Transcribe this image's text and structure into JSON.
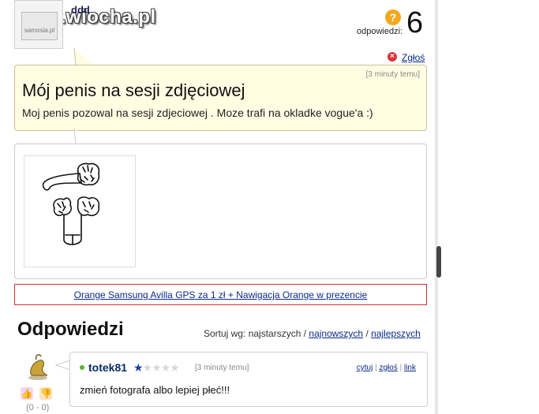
{
  "watermark": "www.wiocha.pl",
  "top": {
    "username": "ddd",
    "avatar_text": "samosia.pl",
    "answers_label": "odpowiedzi:",
    "answers_count": "6",
    "answers_icon": "question-mark-icon",
    "report_label": "Zgłoś"
  },
  "question": {
    "time": "[3 minuty temu]",
    "title": "Mój penis na sesji zdjęciowej",
    "body": "Moj penis pozowal na sesji zdjeciowej . Moze trafi na okladke vogue'a :)"
  },
  "ad": {
    "link_text": "Orange Samsung Avilla GPS za 1 zł + Nawigacja Orange w prezencie"
  },
  "answers": {
    "heading": "Odpowiedzi",
    "sort_label": "Sortuj wg: najstarszych /",
    "sort_newest": "najnowszych",
    "sort_sep": "/",
    "sort_best": "najlepszych"
  },
  "reply": {
    "username": "totek81",
    "rating": 1,
    "rating_max": 5,
    "time": "[3 minuty temu]",
    "action_quote": "cytuj",
    "action_report": "zgłoś",
    "action_link": "link",
    "body": "zmień fotografa albo lepiej płeć!!!",
    "votes": "(0 - 0)"
  },
  "colors": {
    "question_bg": "#fffde2",
    "link": "#0a2a8a",
    "ad_border": "#cc3333",
    "online": "#5cb22c",
    "icon_orange": "#f2a81d"
  }
}
